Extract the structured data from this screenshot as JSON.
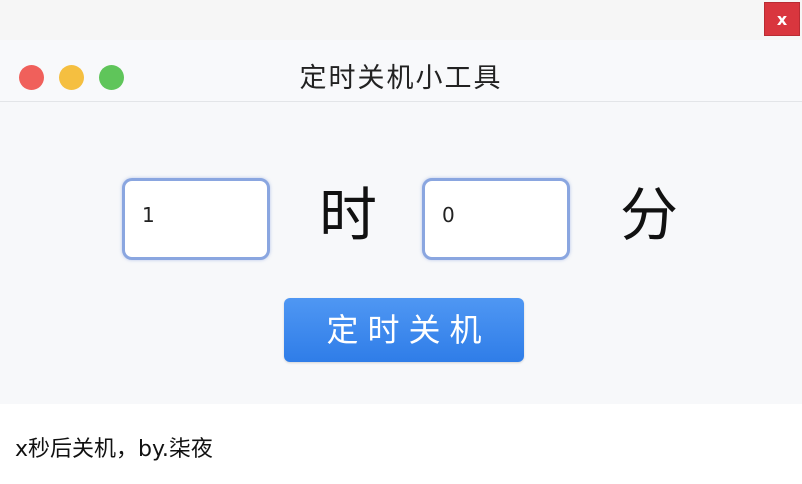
{
  "window": {
    "close_label": "x",
    "title": "定时关机小工具"
  },
  "traffic_lights": {
    "red": "#f0605b",
    "yellow": "#f5bf40",
    "green": "#5fc55a"
  },
  "form": {
    "hours_value": "1",
    "hours_unit": "时",
    "minutes_value": "0",
    "minutes_unit": "分",
    "submit_label": "定时关机"
  },
  "status": {
    "text": "x秒后关机，by.柒夜"
  },
  "colors": {
    "accent": "#2f7de8",
    "close": "#d9363e",
    "input_border": "#8aa6e0"
  }
}
